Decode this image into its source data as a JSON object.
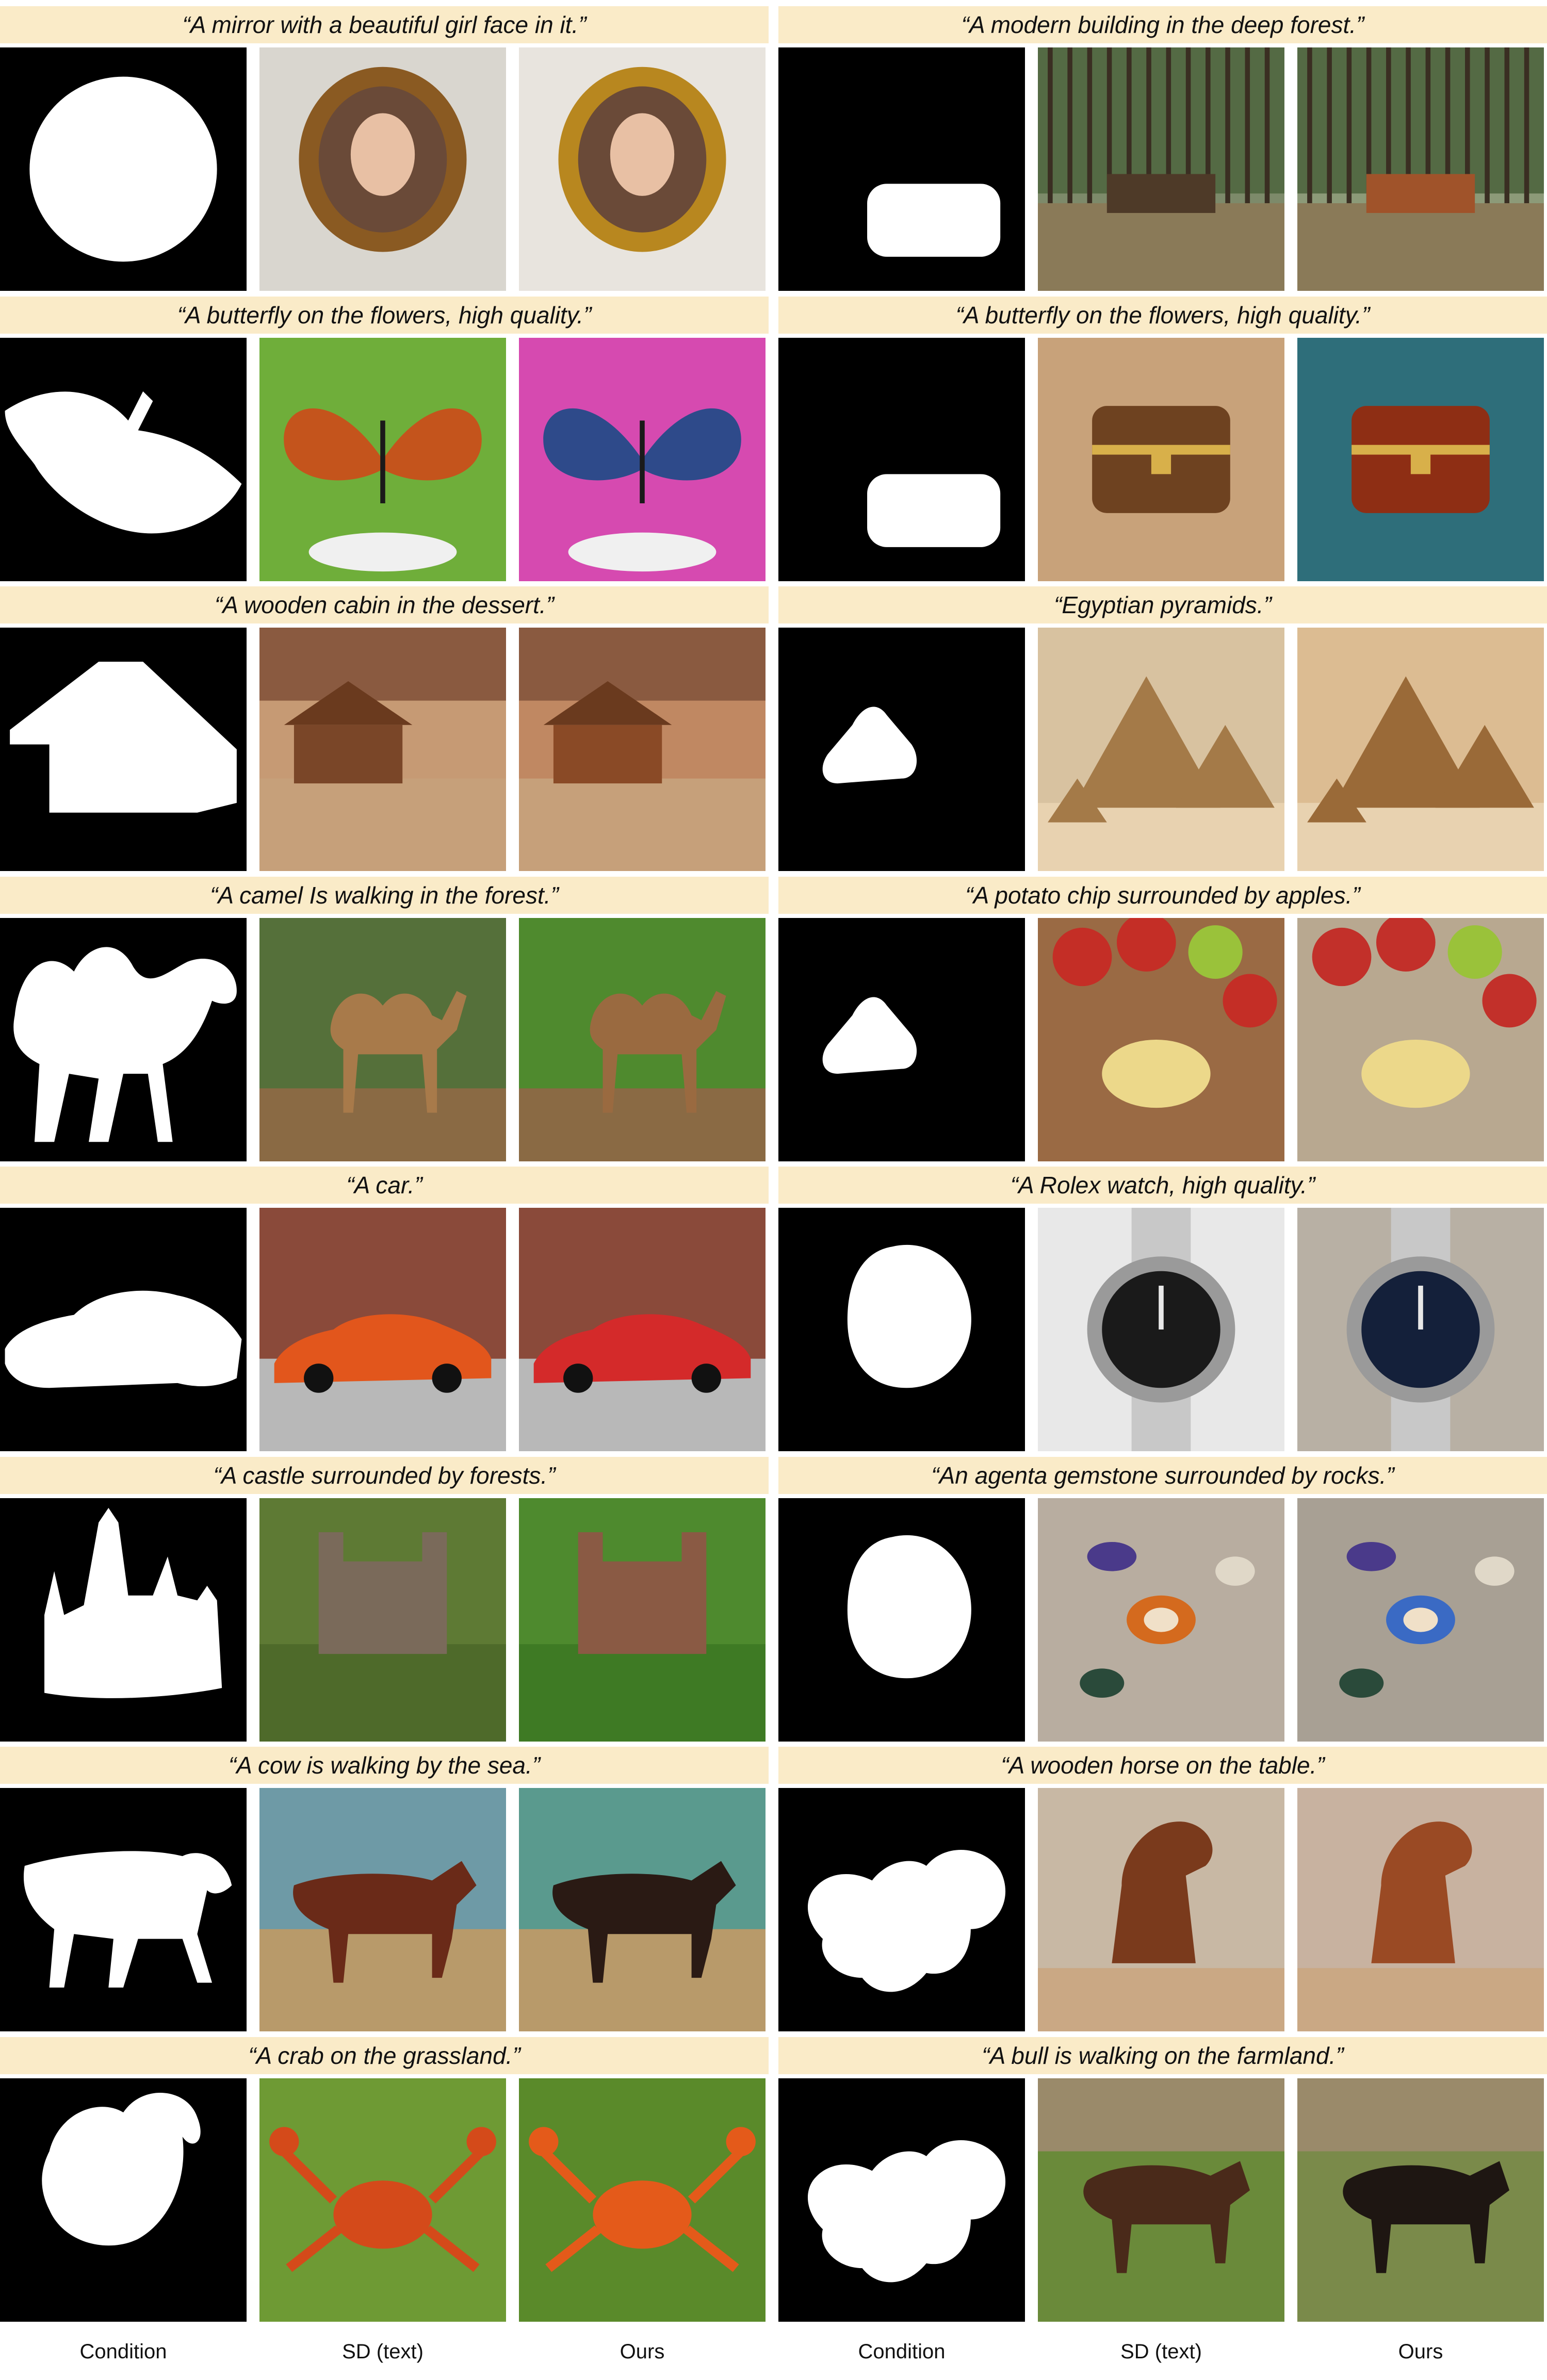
{
  "figure": {
    "column_headers": [
      "Condition",
      "SD (text)",
      "Ours",
      "Condition",
      "SD (text)",
      "Ours"
    ],
    "examples": [
      {
        "caption": "“A mirror with a beautiful girl face in it.”",
        "mask": "circle-mask",
        "sd": {
          "subject": "round-mirror-girl",
          "colors": [
            "#d9d6cf",
            "#8a5a22"
          ]
        },
        "ours": {
          "subject": "round-mirror-girl",
          "colors": [
            "#e8e4de",
            "#b8871f"
          ]
        }
      },
      {
        "caption": "“A modern building in the deep forest.”",
        "mask": "box-mask",
        "sd": {
          "subject": "forest-building",
          "colors": [
            "#7d8a6a",
            "#4e3a28"
          ]
        },
        "ours": {
          "subject": "forest-building",
          "colors": [
            "#8c9a78",
            "#a0532a"
          ]
        }
      },
      {
        "caption": "“A butterfly on the flowers, high quality.”",
        "mask": "butterfly-mask",
        "sd": {
          "subject": "butterfly",
          "colors": [
            "#6fae3a",
            "#c4541c"
          ]
        },
        "ours": {
          "subject": "butterfly",
          "colors": [
            "#d64ab0",
            "#2e4a8a"
          ]
        }
      },
      {
        "caption": "“A butterfly on the flowers, high quality.”",
        "mask": "box-mask",
        "sd": {
          "subject": "treasure-chest",
          "colors": [
            "#c8a27a",
            "#6e4220"
          ]
        },
        "ours": {
          "subject": "treasure-chest",
          "colors": [
            "#2e6e7a",
            "#8e2e14"
          ]
        }
      },
      {
        "caption": "“A wooden cabin in the dessert.”",
        "mask": "cabin-mask",
        "sd": {
          "subject": "wooden-cabin",
          "colors": [
            "#c69a74",
            "#7a4628"
          ]
        },
        "ours": {
          "subject": "wooden-cabin",
          "colors": [
            "#c08862",
            "#8a4a26"
          ]
        }
      },
      {
        "caption": "“Egyptian pyramids.”",
        "mask": "triangle-mask",
        "sd": {
          "subject": "pyramids",
          "colors": [
            "#d8c2a0",
            "#a47a48"
          ]
        },
        "ours": {
          "subject": "pyramids",
          "colors": [
            "#dcbc92",
            "#9a6a38"
          ]
        }
      },
      {
        "caption": "“A camel Is walking in the forest.”",
        "mask": "camel-mask",
        "sd": {
          "subject": "camel",
          "colors": [
            "#55703a",
            "#a87a4a"
          ]
        },
        "ours": {
          "subject": "camel",
          "colors": [
            "#4f8a2e",
            "#9a6a40"
          ]
        }
      },
      {
        "caption": "“A potato chip surrounded by apples.”",
        "mask": "triangle-mask",
        "sd": {
          "subject": "chips-and-apples",
          "colors": [
            "#9a6a44",
            "#c42e26"
          ]
        },
        "ours": {
          "subject": "chips-and-apples",
          "colors": [
            "#b8a890",
            "#c2302a"
          ]
        }
      },
      {
        "caption": "“A car.”",
        "mask": "car-mask",
        "sd": {
          "subject": "car",
          "colors": [
            "#8a4a3a",
            "#e2561c"
          ]
        },
        "ours": {
          "subject": "car",
          "colors": [
            "#8a4a3a",
            "#d42a2a"
          ]
        }
      },
      {
        "caption": "“A Rolex watch, high quality.”",
        "mask": "blob-mask",
        "sd": {
          "subject": "wristwatch",
          "colors": [
            "#e8e8e8",
            "#1a1a1a"
          ]
        },
        "ours": {
          "subject": "wristwatch",
          "colors": [
            "#b8b0a4",
            "#14203a"
          ]
        }
      },
      {
        "caption": "“A castle surrounded by forests.”",
        "mask": "castle-mask",
        "sd": {
          "subject": "castle",
          "colors": [
            "#5e7a34",
            "#7a6a5a"
          ]
        },
        "ours": {
          "subject": "castle",
          "colors": [
            "#4e8a2e",
            "#8a5a44"
          ]
        }
      },
      {
        "caption": "“An agenta gemstone surrounded by rocks.”",
        "mask": "blob-mask",
        "sd": {
          "subject": "gemstones",
          "colors": [
            "#b8ada0",
            "#d46a1e"
          ]
        },
        "ours": {
          "subject": "gemstones",
          "colors": [
            "#a8a094",
            "#3a6ac4"
          ]
        }
      },
      {
        "caption": "“A cow is walking by the sea.”",
        "mask": "cow-mask",
        "sd": {
          "subject": "cow",
          "colors": [
            "#6e9aa6",
            "#6a2a18"
          ]
        },
        "ours": {
          "subject": "cow",
          "colors": [
            "#5a9a8e",
            "#2a1a14"
          ]
        }
      },
      {
        "caption": "“A wooden horse on the table.”",
        "mask": "horse-mask",
        "sd": {
          "subject": "wooden-horse",
          "colors": [
            "#c8b8a4",
            "#7a3a1c"
          ]
        },
        "ours": {
          "subject": "wooden-horse",
          "colors": [
            "#c8b2a0",
            "#9a4a24"
          ]
        }
      },
      {
        "caption": "“A crab on the grassland.”",
        "mask": "crab-mask",
        "sd": {
          "subject": "crab",
          "colors": [
            "#6e9a34",
            "#d44a1a"
          ]
        },
        "ours": {
          "subject": "crab",
          "colors": [
            "#5a8a2a",
            "#e45a1a"
          ]
        }
      },
      {
        "caption": "“A bull is walking on the farmland.”",
        "mask": "horse-mask",
        "sd": {
          "subject": "bull",
          "colors": [
            "#6a8a3a",
            "#4a2a1a"
          ]
        },
        "ours": {
          "subject": "bull",
          "colors": [
            "#7a8a4a",
            "#1e1612"
          ]
        }
      }
    ]
  }
}
